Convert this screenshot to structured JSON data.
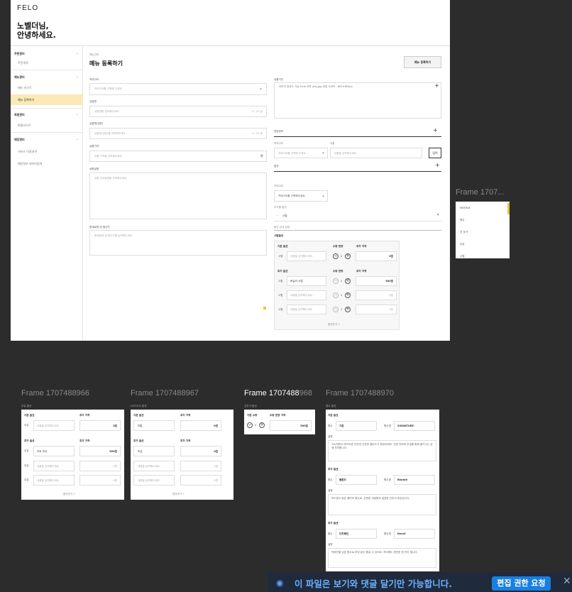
{
  "app": {
    "logo": "FELO"
  },
  "greeting": {
    "line1": "노벨더님,",
    "line2": "안녕하세요."
  },
  "sidebar": {
    "groups": [
      {
        "label": "주문관리",
        "items": [
          "주문내역"
        ]
      },
      {
        "label": "메뉴관리",
        "items": [
          "메뉴 리스트",
          "메뉴 등록하기"
        ]
      },
      {
        "label": "회원관리",
        "items": [
          "회원리스트"
        ]
      },
      {
        "label": "매장관리",
        "items": [
          "서비스 이용내역",
          "매장정보 데이터입력"
        ]
      }
    ]
  },
  "page": {
    "breadcrumb": "메뉴관리",
    "title": "메뉴 등록하기",
    "submit_label": "메뉴 등록하기"
  },
  "form": {
    "category_label": "카테고리",
    "category_placeholder": "카테고리를 선택해 주세요.",
    "name_label": "상품명",
    "name_placeholder": "상품명을 입력해주세요.",
    "name_count": "0 / 10 글",
    "name_en_label": "상품명(영문)",
    "name_en_placeholder": "상품명(영문)을 입력해주세요.",
    "name_en_count": "0 / 20 글",
    "price_label": "상품가격",
    "price_placeholder": "상품 가격을 입력해주세요.",
    "price_unit": "원",
    "desc_label": "상품설명",
    "desc_placeholder": "상품 상세설명을 입력해주세요.",
    "origin_label": "원재료명 및 원산지",
    "origin_placeholder": "원재료명 및 원산지를 입력해주세요.",
    "image_label": "상품사진",
    "image_placeholder": "이미지 업로드 가능 5mb 이하 png,jpg 권장 사이즈 : 800×800px",
    "nutrition_label": "영양정보",
    "nutrition_cat_label": "카테고리",
    "nutrition_cat_placeholder": "카테고리를 선택해 주세요.",
    "nutrition_val_label": "내용",
    "nutrition_val_placeholder": "내용을 입력해주세요.",
    "nutrition_btn": "입력",
    "option_label": "옵션",
    "option_cat_label": "카테고리",
    "option_cat_placeholder": "카테고리를 선택해주세요.",
    "option_add_label": "추가할 옵션",
    "option_chip": "시럽",
    "option_detail_label": "옵션 상세 설정",
    "option_name": "시럽옵션",
    "base_option_label": "기본 옵션",
    "qty_label": "수량 변경",
    "extra_price_label": "추가 가격",
    "base_row": {
      "name": "시럽",
      "placeholder": "내용을 입력해주세요.",
      "qty": "2",
      "price": "0원"
    },
    "add_option_label": "추가 옵션",
    "add_rows": [
      {
        "name": "시럽",
        "value": "바닐라 시럽",
        "qty": "1",
        "price": "500원"
      },
      {
        "name": "시럽",
        "value": "내용을 입력해주세요.",
        "qty": "1",
        "price": "0원"
      },
      {
        "name": "시럽",
        "value": "내용을 입력해주세요.",
        "qty": "1",
        "price": "0원"
      }
    ],
    "add_more": "옵션추가 +"
  },
  "side_frame": {
    "title": "Frame 1707...",
    "items": [
      "HOT/ICE",
      "원두",
      "샷 추가",
      "우유",
      "시럽"
    ]
  },
  "frames": [
    {
      "title": "Frame 1707488966",
      "header": "우유 옵션",
      "base_label": "기본 옵션",
      "price_label": "추가 가격",
      "base_row": {
        "name": "우유",
        "value": "내용을 입력해주세요.",
        "price": "0원"
      },
      "add_label": "추가 옵션",
      "rows": [
        {
          "name": "우유",
          "value": "오트 우유",
          "price": "500원"
        },
        {
          "name": "우유",
          "value": "내용을 입력해주세요.",
          "price": "0원"
        },
        {
          "name": "우유",
          "value": "내용을 입력해주세요.",
          "price": "0원"
        }
      ],
      "more": "옵션추가 +"
    },
    {
      "title": "Frame 1707488967",
      "header": "HOT/ICE 옵션",
      "base_label": "기본 옵션",
      "price_label": "추가 가격",
      "base_row": {
        "name": "",
        "value": "보통",
        "price": "0원"
      },
      "add_label": "추가 옵션",
      "rows": [
        {
          "name": "",
          "value": "조금",
          "price": "0원"
        },
        {
          "name": "",
          "value": "내용을 입력해주세요.",
          "price": "0원"
        },
        {
          "name": "",
          "value": "내용을 입력해주세요.",
          "price": "0원"
        }
      ],
      "more": "옵션추가 +"
    },
    {
      "title_a": "Frame 1707488",
      "title_b": "968",
      "header": "샷추가 옵션",
      "base_label": "기본 수량",
      "qty_label": "수량 변경 가격",
      "qty": "2",
      "price": "500원"
    },
    {
      "title": "Frame 1707488970",
      "header": "원두 옵션",
      "sections": [
        {
          "label": "기본 옵션",
          "bean_label": "원두",
          "bean": "기본",
          "name_label": "원두명",
          "name": "SIGNATURE",
          "desc_label": "설명",
          "desc": "고소하면서 부드러운 단맛과 산뜻한 밸런스가 특징이에요. 진한 커피와 우유를 함께 즐기시는 분께 추천합니다."
        },
        {
          "label": "추가 옵션",
          "bean_label": "원두",
          "bean": "블론드",
          "name_label": "원두명",
          "name": "Blonde",
          "desc_label": "설명",
          "desc": "부드럽고 밝은 풍미의 원두로, 산뜻한 과일향과 깔끔한 단맛이 특징입니다."
        },
        {
          "label": "추가 옵션",
          "bean_label": "원두",
          "bean": "디카페인",
          "name_label": "원두명",
          "name": "Decaf",
          "desc_label": "설명",
          "desc": "카페인을 낮춘 원두로 부담 없이 즐길 수 있어요. 저녁에도 편안한 한 잔이 됩니다."
        }
      ]
    }
  ],
  "notice": {
    "text": "이 파일은 보기와 댓글 달기만 가능합니다.",
    "button": "편집 권한 요청",
    "close": "✕"
  }
}
